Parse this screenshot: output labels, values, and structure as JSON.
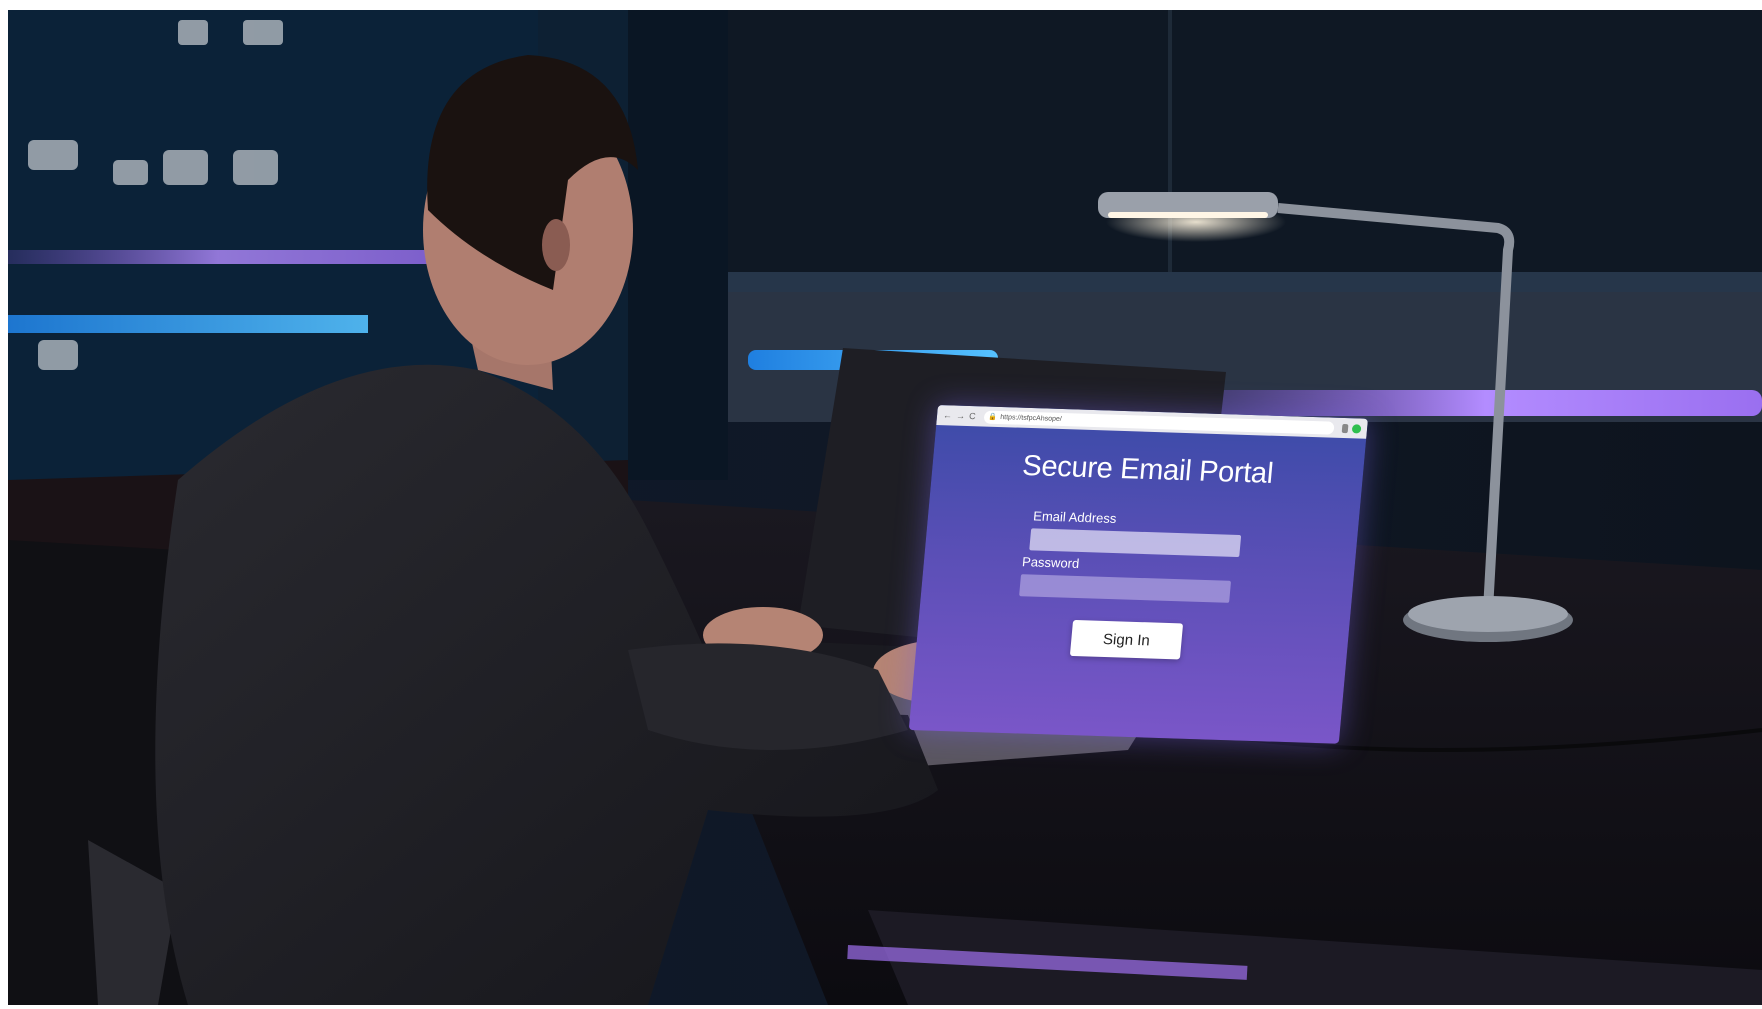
{
  "browser": {
    "back_glyph": "←",
    "forward_glyph": "→",
    "reload_glyph": "C",
    "lock_glyph": "🔒",
    "url": "https://tsfpcAhsope/"
  },
  "portal": {
    "title": "Secure Email Portal",
    "email_label": "Email Address",
    "email_value": "",
    "password_label": "Password",
    "password_value": "",
    "signin_label": "Sign In"
  },
  "colors": {
    "screen_top": "#3b4ba8",
    "screen_bottom": "#7a56c8",
    "accent_neon_purple": "#9a6ff0",
    "accent_neon_blue": "#3fa9ff"
  }
}
